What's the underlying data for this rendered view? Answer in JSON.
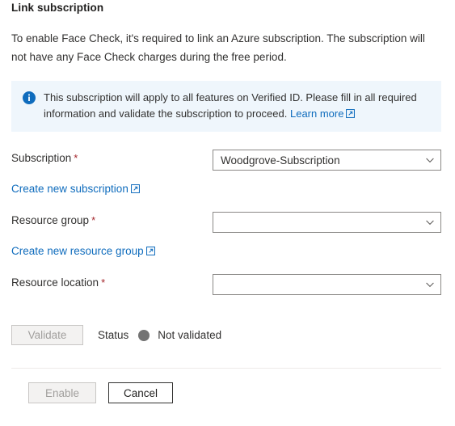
{
  "page": {
    "title": "Link subscription",
    "intro": "To enable Face Check, it's required to link an Azure subscription. The subscription will not have any Face Check charges during the free period."
  },
  "banner": {
    "icon": "info-circle-icon",
    "text": "This subscription will apply to all features on Verified ID. Please fill in all required information and validate the subscription to proceed.",
    "link_label": "Learn more",
    "link_icon": "external-link-icon",
    "background_color": "#eff6fc",
    "icon_color": "#0f6cbd"
  },
  "form": {
    "required_marker": "*",
    "fields": [
      {
        "label": "Subscription",
        "required": true,
        "value": "Woodgrove-Subscription",
        "placeholder": "",
        "icon": "chevron-down-icon"
      },
      {
        "label": "Resource group",
        "required": true,
        "value": "",
        "placeholder": "",
        "icon": "chevron-down-icon"
      },
      {
        "label": "Resource location",
        "required": true,
        "value": "",
        "placeholder": "",
        "icon": "chevron-down-icon"
      }
    ],
    "links": [
      {
        "label": "Create new subscription",
        "icon": "external-link-icon"
      },
      {
        "label": "Create new resource group",
        "icon": "external-link-icon"
      }
    ]
  },
  "validation": {
    "validate_button": "Validate",
    "validate_disabled": true,
    "status_label": "Status",
    "status_value": "Not validated",
    "status_color": "#737373"
  },
  "footer": {
    "enable_button": "Enable",
    "enable_disabled": true,
    "cancel_button": "Cancel"
  },
  "colors": {
    "link": "#0f6cbd",
    "required_asterisk": "#a4262c",
    "text": "#323130",
    "disabled_text": "#a19f9d"
  }
}
